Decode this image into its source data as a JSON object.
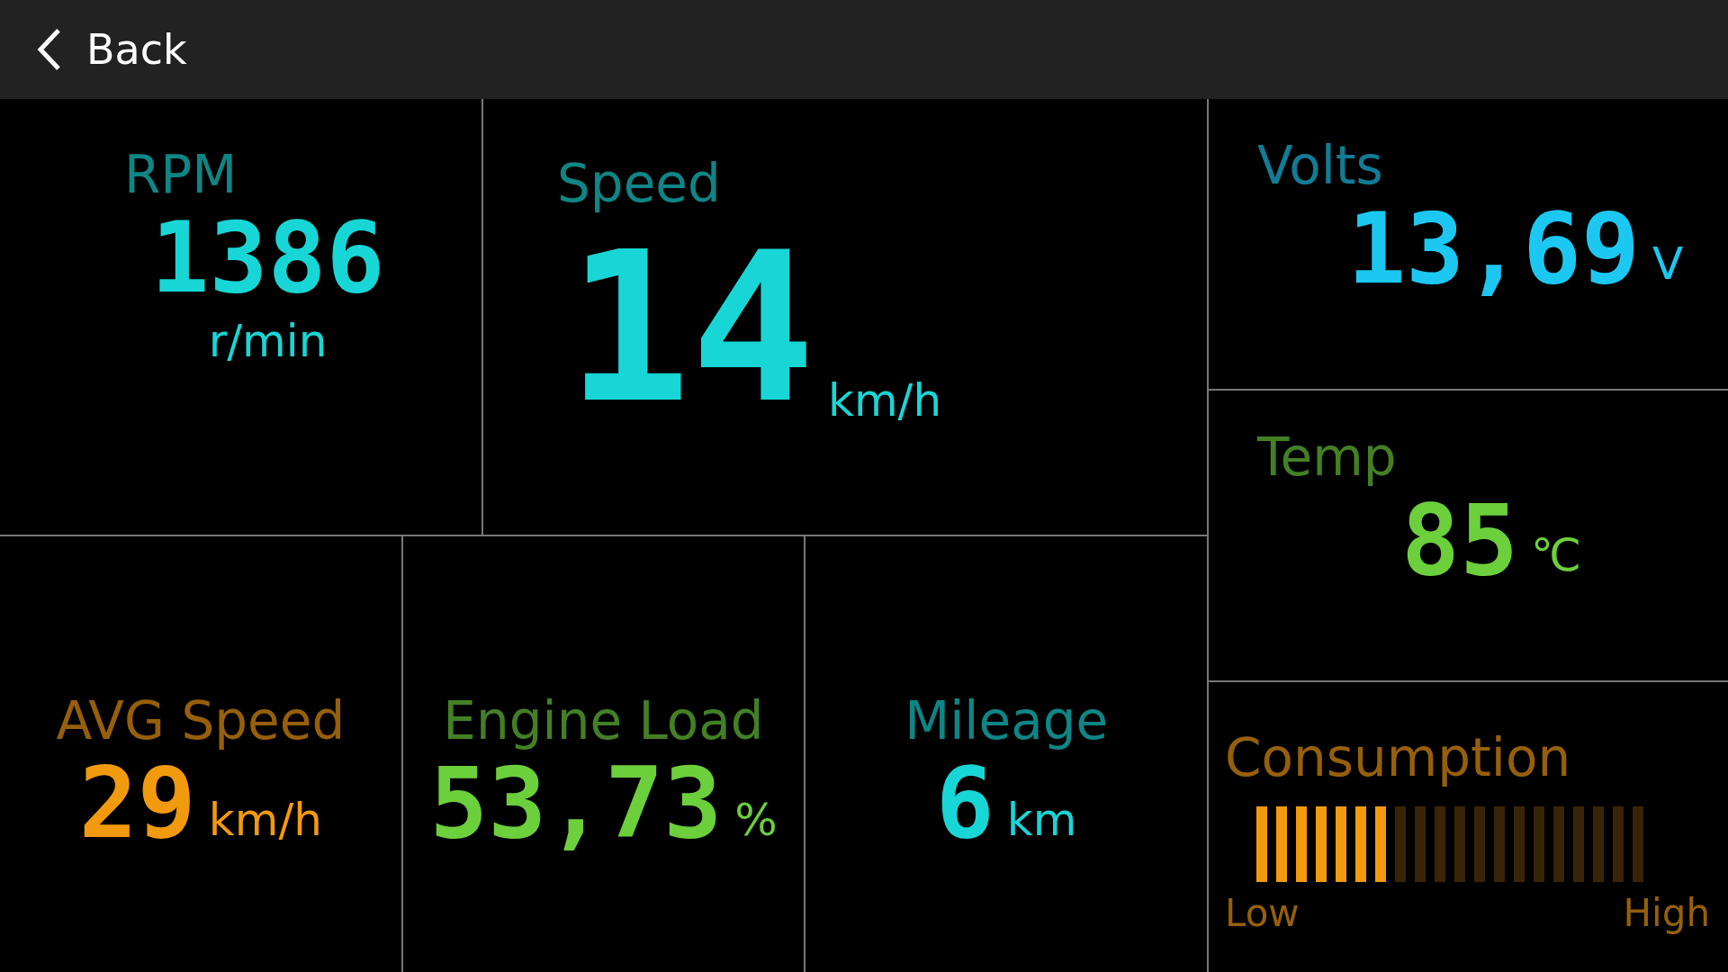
{
  "header": {
    "back_label": "Back"
  },
  "top_row": [
    {
      "kind": "stacked",
      "title": "RPM",
      "value": "1386",
      "unit": "r/min",
      "color": "#18d6d6"
    },
    {
      "kind": "large",
      "title": "Speed",
      "value": "14",
      "unit": "km/h",
      "color": "#18d6d6"
    }
  ],
  "bottom_row": [
    {
      "kind": "inline",
      "title": "AVG Speed",
      "value": "29",
      "unit": "km/h",
      "color": "#f29a0e"
    },
    {
      "kind": "inline",
      "title": "Engine Load",
      "value": "53,73",
      "unit": "%",
      "color": "#6ccf3c"
    },
    {
      "kind": "inline",
      "title": "Mileage",
      "value": "6",
      "unit": "km",
      "color": "#18d6d6"
    }
  ],
  "side_column": [
    {
      "kind": "inline",
      "title": "Volts",
      "value": "13,69",
      "unit": "V",
      "color": "#1cc8f2"
    },
    {
      "kind": "inline",
      "title": "Temp",
      "value": "85",
      "unit": "℃",
      "color": "#6ccf3c"
    },
    {
      "kind": "bar",
      "title": "Consumption",
      "level": 0.35,
      "low_label": "Low",
      "high_label": "High",
      "color": "#f29a0e"
    }
  ]
}
